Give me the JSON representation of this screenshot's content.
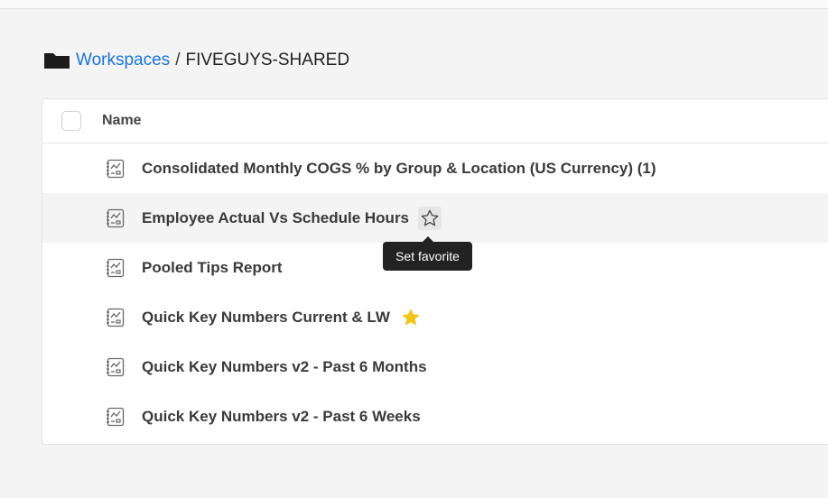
{
  "breadcrumb": {
    "root": "Workspaces",
    "separator": "/",
    "current": "FIVEGUYS-SHARED"
  },
  "table": {
    "column_name": "Name",
    "rows": [
      {
        "label": "Consolidated Monthly COGS % by Group & Location (US Currency) (1)",
        "favorite": false
      },
      {
        "label": "Employee Actual Vs Schedule Hours",
        "favorite": false,
        "hovered": true
      },
      {
        "label": "Pooled Tips Report",
        "favorite": false
      },
      {
        "label": "Quick Key Numbers Current & LW",
        "favorite": true
      },
      {
        "label": "Quick Key Numbers v2 - Past 6 Months",
        "favorite": false
      },
      {
        "label": "Quick Key Numbers v2 - Past 6 Weeks",
        "favorite": false
      }
    ]
  },
  "tooltip": {
    "text": "Set favorite"
  },
  "icons": {
    "folder": "folder-icon",
    "report": "report-icon",
    "star_outline": "star-outline-icon",
    "star_filled": "star-filled-icon"
  },
  "colors": {
    "link": "#1a73d9",
    "favorite": "#f2c417",
    "tooltip_bg": "#222222"
  }
}
